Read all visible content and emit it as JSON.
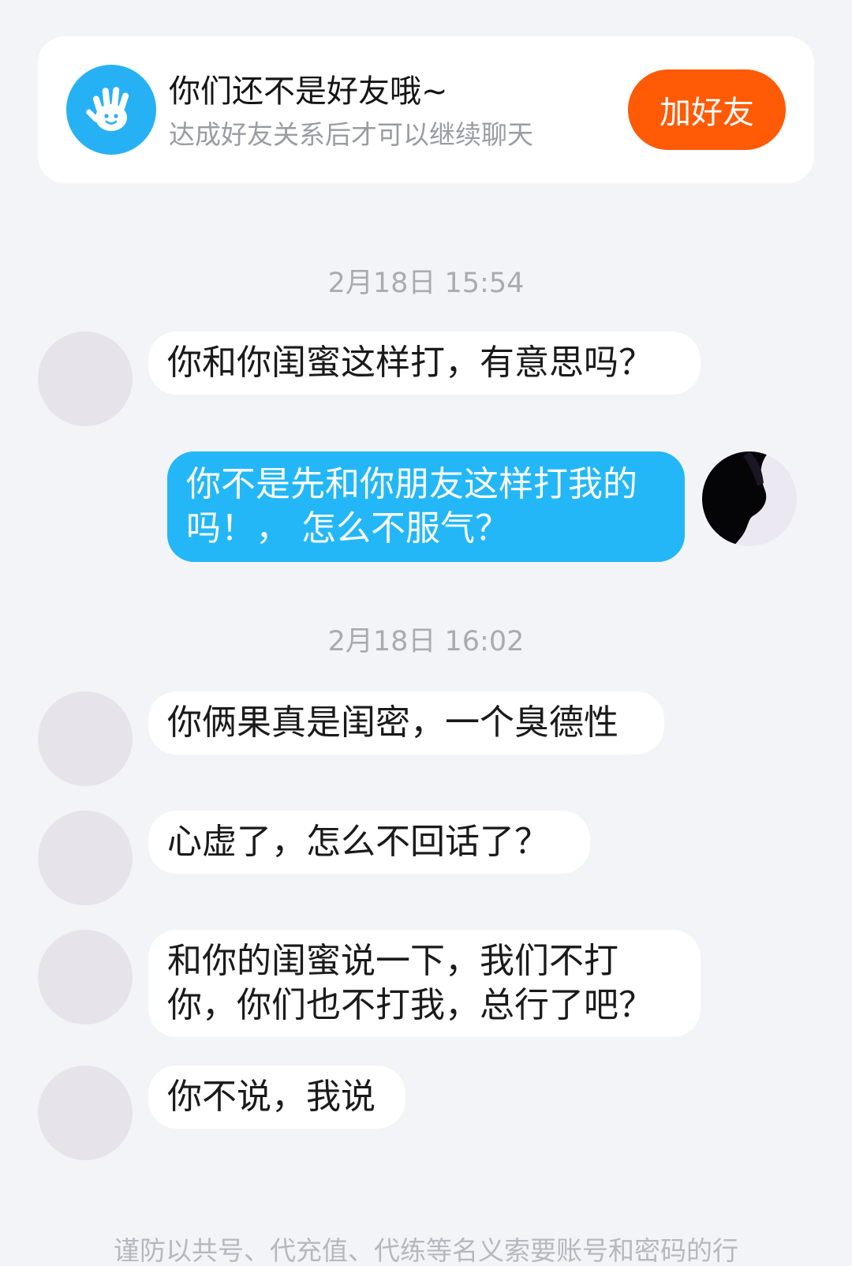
{
  "notice": {
    "title": "你们还不是好友哦~",
    "subtitle": "达成好友关系后才可以继续聊天",
    "button_label": "加好友",
    "icon": "waving-hand-icon",
    "accent_color": "#27b1f5",
    "button_color": "#ff5a06"
  },
  "messages": [
    {
      "type": "time",
      "text": "2月18日 15:54"
    },
    {
      "type": "in",
      "lines": [
        "你和你闺蜜这样打，有意思吗？"
      ]
    },
    {
      "type": "out",
      "lines": [
        "你不是先和你朋友这样打我的",
        "吗！，  怎么不服气？"
      ]
    },
    {
      "type": "time",
      "text": "2月18日 16:02"
    },
    {
      "type": "in",
      "lines": [
        "你俩果真是闺密，一个臭德性"
      ]
    },
    {
      "type": "in",
      "lines": [
        "心虚了，怎么不回话了？"
      ]
    },
    {
      "type": "in",
      "lines": [
        "和你的闺蜜说一下，我们不打",
        "你，你们也不打我，总行了吧？"
      ]
    },
    {
      "type": "in",
      "lines": [
        "你不说，我说"
      ]
    }
  ],
  "footer": {
    "text": "谨防以共号、代充值、代练等名义索要账号和密码的行"
  },
  "colors": {
    "background": "#f3f4f8",
    "incoming_bubble": "#ffffff",
    "outgoing_bubble": "#23b7f7"
  }
}
